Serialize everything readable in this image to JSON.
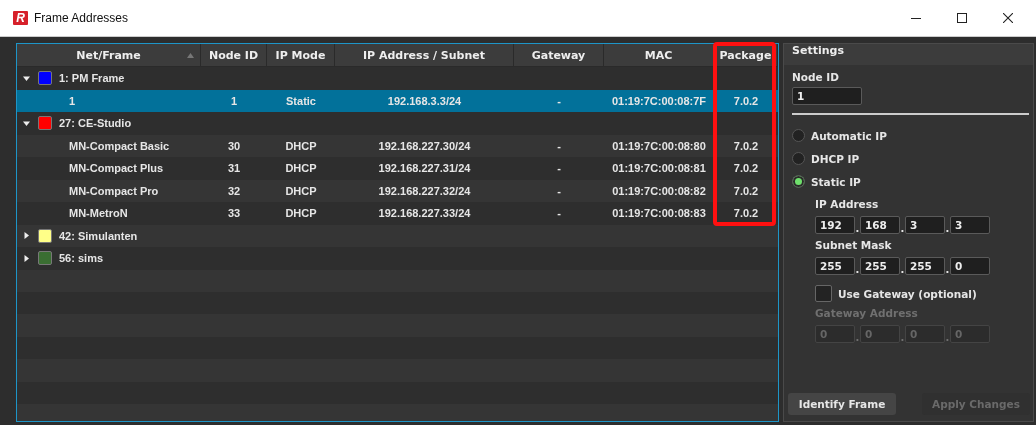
{
  "window": {
    "logo": "R",
    "title": "Frame Addresses"
  },
  "table": {
    "columns": [
      {
        "label": "Net/Frame",
        "sorted": true
      },
      {
        "label": "Node ID",
        "sorted": false
      },
      {
        "label": "IP Mode",
        "sorted": false
      },
      {
        "label": "IP Address / Subnet",
        "sorted": false
      },
      {
        "label": "Gateway",
        "sorted": false
      },
      {
        "label": "MAC",
        "sorted": false
      },
      {
        "label": "Package",
        "sorted": false,
        "highlighted": true
      }
    ],
    "groups": [
      {
        "label": "1: PM Frame",
        "color": "#0000ff",
        "expanded": true,
        "selected": false,
        "children": [
          {
            "name": "1",
            "node_id": "1",
            "ip_mode": "Static",
            "ip": "192.168.3.3/24",
            "gateway": "-",
            "mac": "01:19:7C:00:08:7F",
            "package": "7.0.2",
            "selected": true
          }
        ]
      },
      {
        "label": "27: CE-Studio",
        "color": "#ff0000",
        "expanded": true,
        "selected": false,
        "children": [
          {
            "name": "MN-Compact Basic",
            "node_id": "30",
            "ip_mode": "DHCP",
            "ip": "192.168.227.30/24",
            "gateway": "-",
            "mac": "01:19:7C:00:08:80",
            "package": "7.0.2",
            "selected": false
          },
          {
            "name": "MN-Compact Plus",
            "node_id": "31",
            "ip_mode": "DHCP",
            "ip": "192.168.227.31/24",
            "gateway": "-",
            "mac": "01:19:7C:00:08:81",
            "package": "7.0.2",
            "selected": false
          },
          {
            "name": "MN-Compact Pro",
            "node_id": "32",
            "ip_mode": "DHCP",
            "ip": "192.168.227.32/24",
            "gateway": "-",
            "mac": "01:19:7C:00:08:82",
            "package": "7.0.2",
            "selected": false
          },
          {
            "name": "MN-MetroN",
            "node_id": "33",
            "ip_mode": "DHCP",
            "ip": "192.168.227.33/24",
            "gateway": "-",
            "mac": "01:19:7C:00:08:83",
            "package": "7.0.2",
            "selected": false
          }
        ]
      },
      {
        "label": "42: Simulanten",
        "color": "#ffff88",
        "expanded": false,
        "selected": false
      },
      {
        "label": "56: sims",
        "color": "#3a6e32",
        "expanded": false,
        "selected": false
      }
    ]
  },
  "settings": {
    "title": "Settings",
    "node_id_label": "Node ID",
    "node_id": "1",
    "modes": [
      {
        "label": "Automatic IP",
        "selected": false
      },
      {
        "label": "DHCP IP",
        "selected": false
      },
      {
        "label": "Static IP",
        "selected": true
      }
    ],
    "ip_label": "IP Address",
    "ip": [
      "192",
      "168",
      "3",
      "3"
    ],
    "subnet_label": "Subnet Mask",
    "subnet": [
      "255",
      "255",
      "255",
      "0"
    ],
    "gateway_checkbox": {
      "label": "Use Gateway (optional)",
      "checked": false
    },
    "gateway_label": "Gateway Address",
    "gateway": [
      "0",
      "0",
      "0",
      "0"
    ],
    "gateway_disabled": true,
    "separator": ".",
    "buttons": [
      {
        "label": "Identify Frame",
        "disabled": false
      },
      {
        "label": "Apply Changes",
        "disabled": true
      }
    ]
  }
}
